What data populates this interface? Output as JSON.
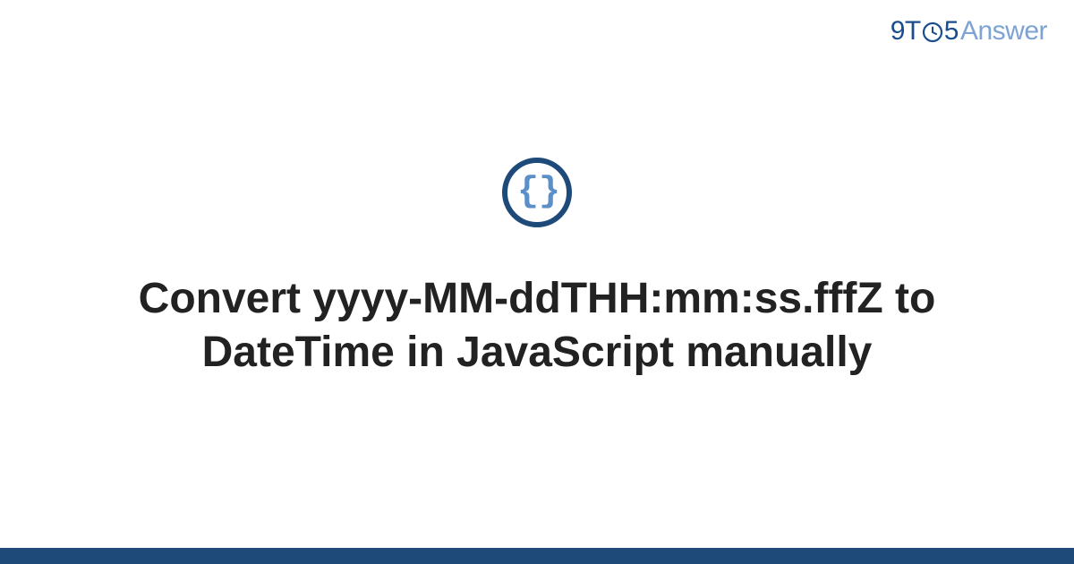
{
  "header": {
    "logo": {
      "part1": "9T",
      "part2": "5",
      "part3": "Answer"
    }
  },
  "main": {
    "icon_name": "code-braces-icon",
    "title": "Convert yyyy-MM-ddTHH:mm:ss.fffZ to DateTime in JavaScript manually"
  },
  "colors": {
    "brand_dark": "#1e4a7a",
    "brand_light": "#5a8fc7",
    "logo_primary": "#1a4d8f",
    "logo_secondary": "#7da3d4"
  }
}
